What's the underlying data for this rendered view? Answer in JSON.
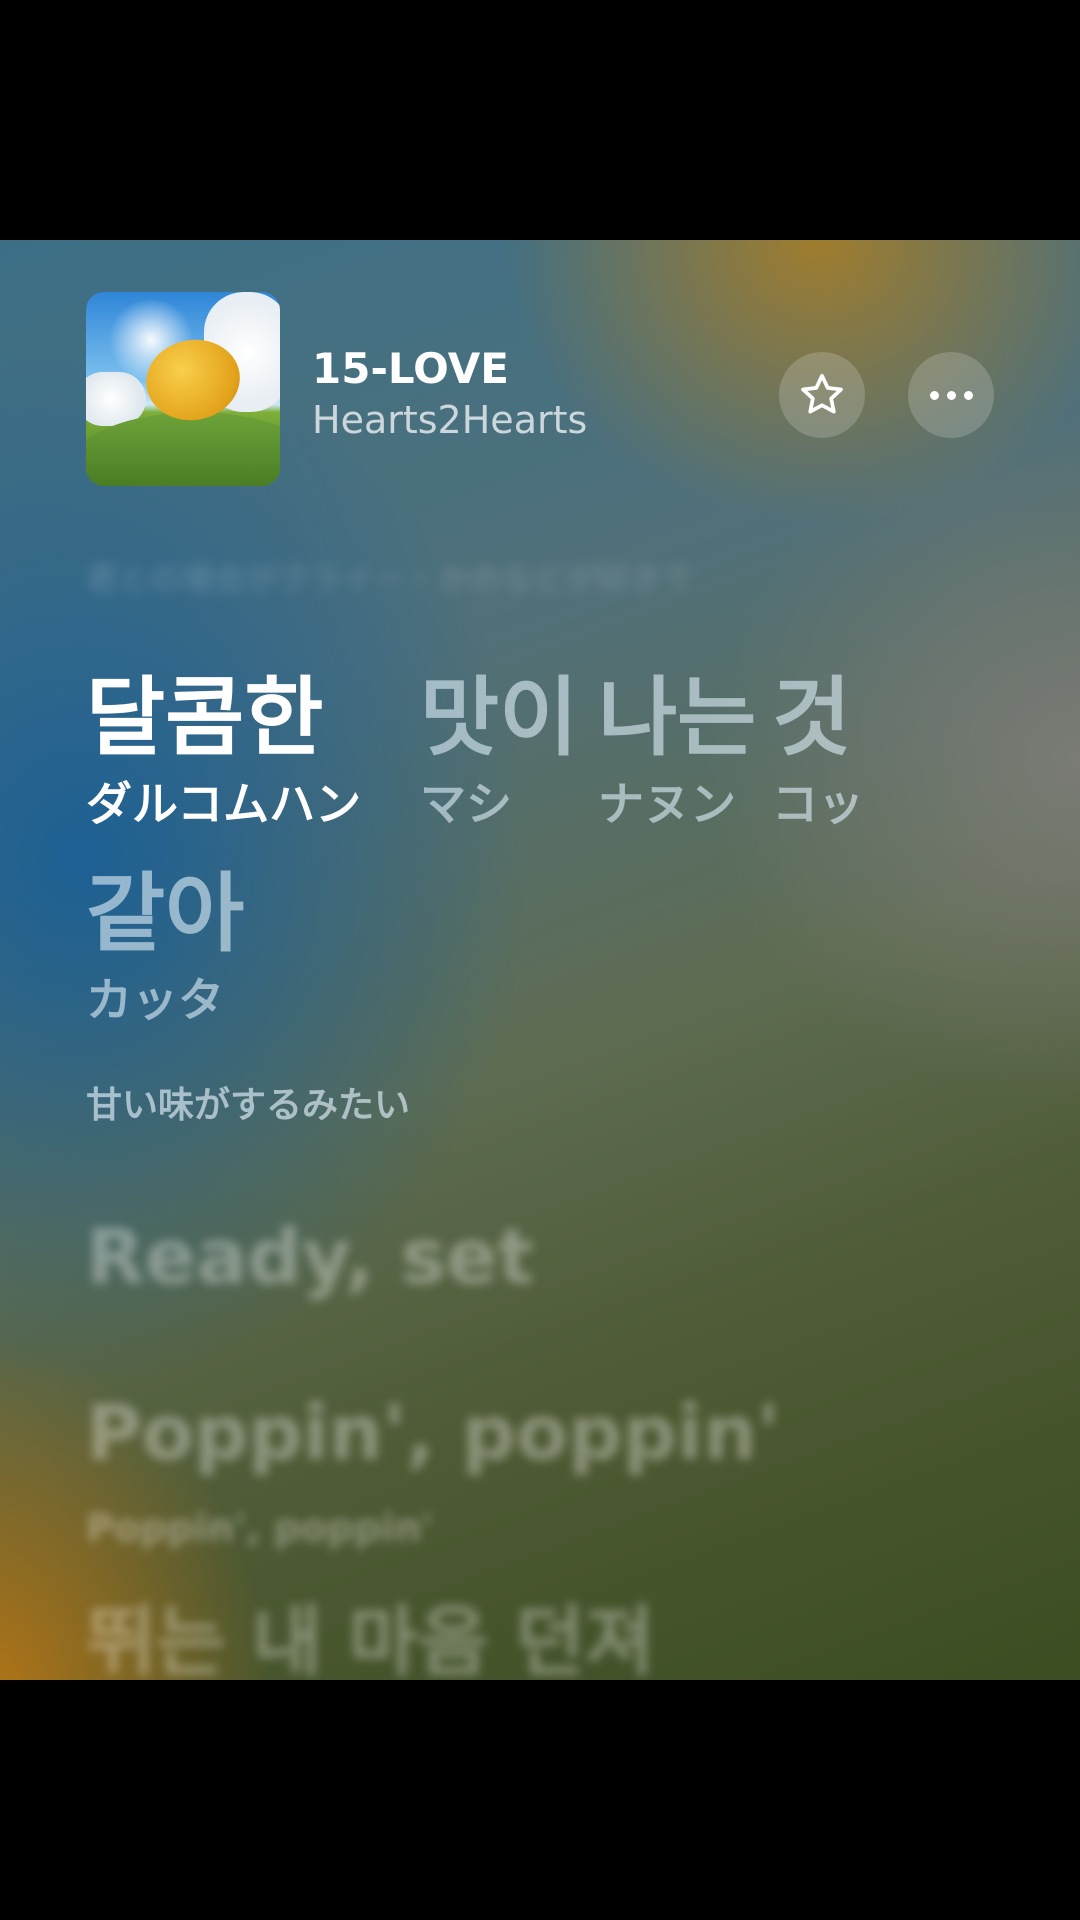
{
  "track": {
    "title": "15-LOVE",
    "artist": "Hearts2Hearts"
  },
  "icons": {
    "favorite": "star-outline-icon",
    "more": "ellipsis-icon"
  },
  "lyrics": {
    "previous_line": "君との場合がクライー・かのなどが好きで",
    "current": {
      "words": [
        {
          "kr": "달콤한",
          "jp": "ダルコムハン",
          "state": "active"
        },
        {
          "kr": "맛이",
          "jp": "マシ",
          "state": "dim"
        },
        {
          "kr": "나는",
          "jp": "ナヌン",
          "state": "dim"
        },
        {
          "kr": "것",
          "jp": "コッ",
          "state": "dim"
        },
        {
          "kr": "같아",
          "jp": "カッタ",
          "state": "dim"
        }
      ],
      "translation": "甘い味がするみたい"
    },
    "upcoming": [
      {
        "text": "Ready, set"
      },
      {
        "text": "Poppin', poppin'",
        "sub": "Poppin',          poppin'"
      },
      {
        "text": "뛰는   내 마음 던져"
      }
    ]
  }
}
